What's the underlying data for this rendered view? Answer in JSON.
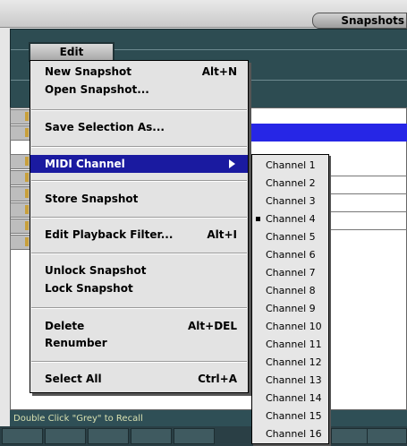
{
  "window": {
    "tab_label": "Snapshots",
    "status_text": "Double Click \"Grey\" to Recall"
  },
  "edit_menu": {
    "button_label": "Edit",
    "items": [
      {
        "label": "New Snapshot",
        "shortcut": "Alt+N"
      },
      {
        "label": "Open Snapshot...",
        "shortcut": ""
      },
      {
        "label": "Save Selection As...",
        "shortcut": ""
      },
      {
        "label": "MIDI Channel",
        "shortcut": "",
        "highlighted": true,
        "submenu": true
      },
      {
        "label": "Store Snapshot",
        "shortcut": ""
      },
      {
        "label": "Edit Playback Filter...",
        "shortcut": "Alt+I"
      },
      {
        "label": "Unlock Snapshot",
        "shortcut": ""
      },
      {
        "label": "Lock Snapshot",
        "shortcut": ""
      },
      {
        "label": "Delete",
        "shortcut": "Alt+DEL"
      },
      {
        "label": "Renumber",
        "shortcut": ""
      },
      {
        "label": "Select All",
        "shortcut": "Ctrl+A"
      }
    ]
  },
  "midi_channel_submenu": {
    "items": [
      {
        "label": "Channel 1",
        "checked": false
      },
      {
        "label": "Channel 2",
        "checked": false
      },
      {
        "label": "Channel 3",
        "checked": false
      },
      {
        "label": "Channel 4",
        "checked": true
      },
      {
        "label": "Channel 5",
        "checked": false
      },
      {
        "label": "Channel 6",
        "checked": false
      },
      {
        "label": "Channel 7",
        "checked": false
      },
      {
        "label": "Channel 8",
        "checked": false
      },
      {
        "label": "Channel 9",
        "checked": false
      },
      {
        "label": "Channel 10",
        "checked": false
      },
      {
        "label": "Channel 11",
        "checked": false
      },
      {
        "label": "Channel 12",
        "checked": false
      },
      {
        "label": "Channel 13",
        "checked": false
      },
      {
        "label": "Channel 14",
        "checked": false
      },
      {
        "label": "Channel 15",
        "checked": false
      },
      {
        "label": "Channel 16",
        "checked": false
      }
    ]
  },
  "colors": {
    "highlight": "#1a1aa0",
    "panel": "#2d4c52",
    "selection_row": "#2626e6"
  }
}
